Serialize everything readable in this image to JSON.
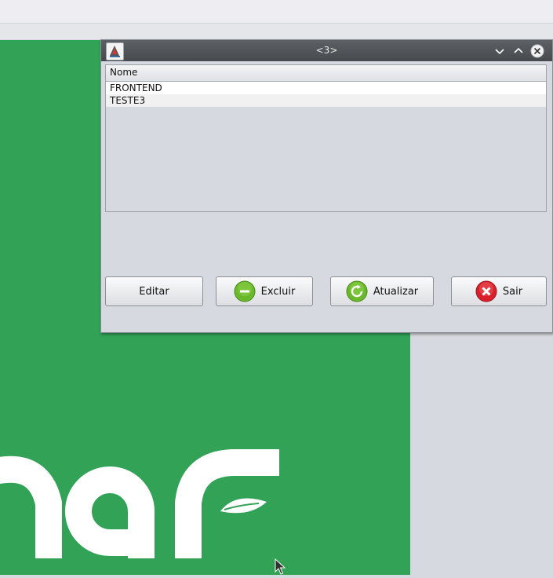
{
  "window": {
    "title": "<3>"
  },
  "table": {
    "columns": [
      "Nome"
    ],
    "rows": [
      [
        "FRONTEND"
      ],
      [
        "TESTE3"
      ]
    ]
  },
  "buttons": {
    "edit": "Editar",
    "delete": "Excluir",
    "refresh": "Atualizar",
    "exit": "Sair"
  },
  "colors": {
    "desktop_green": "#31a256",
    "delete_icon": "#6ab82c",
    "exit_icon": "#d9202a"
  },
  "icons": [
    "app-icon",
    "minimize-icon",
    "maximize-icon",
    "close-icon",
    "minus-circle-icon",
    "refresh-icon",
    "x-circle-icon",
    "mouse-cursor-icon"
  ]
}
